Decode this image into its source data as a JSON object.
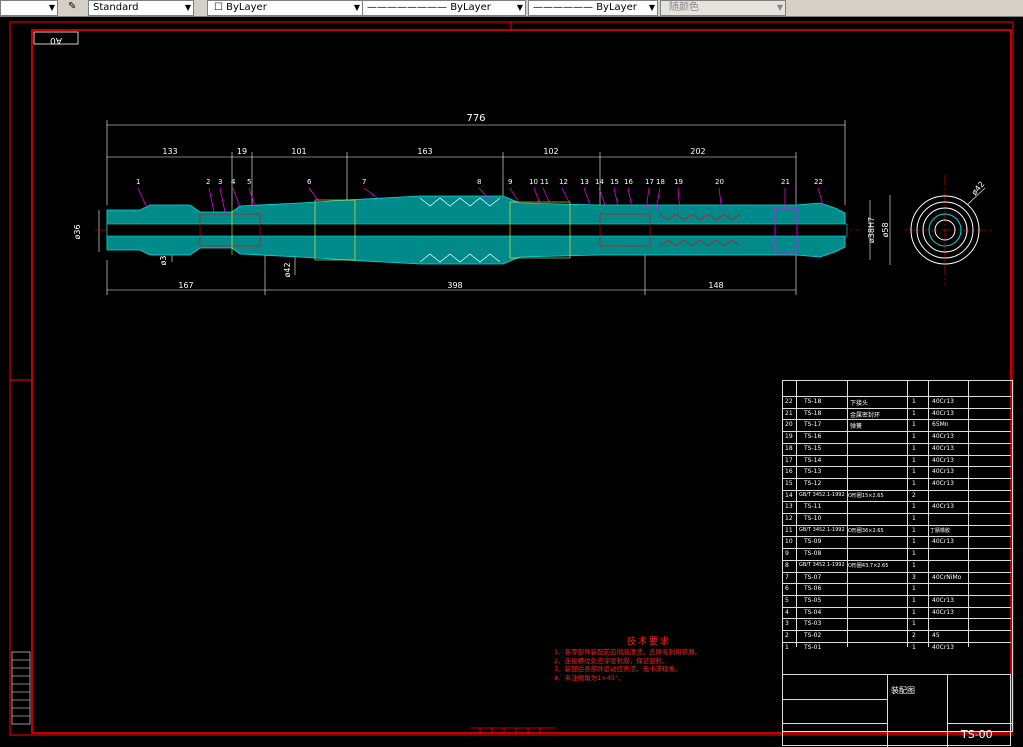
{
  "toolbar": {
    "textstyle": "Standard",
    "color": "ByLayer",
    "linetype": "ByLayer",
    "lineweight": "ByLayer",
    "plotstyle": "随颜色"
  },
  "drawing": {
    "sheet_size": "A0",
    "overall_length": "776",
    "top_dims": [
      "133",
      "19",
      "101",
      "163",
      "102",
      "202"
    ],
    "bottom_dims": [
      "167",
      "398",
      "148"
    ],
    "side_dims": [
      "ø36",
      "ø38",
      "ø42",
      "ø38H7",
      "ø58",
      "ø42"
    ],
    "balloons": [
      "1",
      "2",
      "3",
      "4",
      "5",
      "6",
      "7",
      "8",
      "9",
      "10",
      "11",
      "12",
      "13",
      "14",
      "15",
      "16",
      "17",
      "18",
      "19",
      "20",
      "21",
      "22"
    ]
  },
  "notes": {
    "title": "技术要求",
    "items": [
      "1、各零部件装配前应彻底清洗，去除毛刺和铁屑。",
      "2、连接螺纹处应涂密封胶，保证密封。",
      "3、装配后各部件运动应灵活，无卡滞现象。",
      "4、未注倒角为1×45°。"
    ]
  },
  "bom": [
    {
      "no": "22",
      "code": "TS-18",
      "name": "下接头",
      "qty": "1",
      "mat": "40Cr13"
    },
    {
      "no": "21",
      "code": "TS-18",
      "name": "金属密封环",
      "qty": "1",
      "mat": "40Cr13"
    },
    {
      "no": "20",
      "code": "TS-17",
      "name": "弹簧",
      "qty": "1",
      "mat": "65Mn"
    },
    {
      "no": "19",
      "code": "TS-16",
      "name": "",
      "qty": "1",
      "mat": "40Cr13"
    },
    {
      "no": "18",
      "code": "TS-15",
      "name": "",
      "qty": "1",
      "mat": "40Cr13"
    },
    {
      "no": "17",
      "code": "TS-14",
      "name": "",
      "qty": "1",
      "mat": "40Cr13"
    },
    {
      "no": "16",
      "code": "TS-13",
      "name": "",
      "qty": "1",
      "mat": "40Cr13"
    },
    {
      "no": "15",
      "code": "TS-12",
      "name": "",
      "qty": "1",
      "mat": "40Cr13"
    },
    {
      "no": "14",
      "code": "GB/T 3452.1-1992",
      "name": "O形圈15×2.65",
      "qty": "2",
      "mat": ""
    },
    {
      "no": "13",
      "code": "TS-11",
      "name": "",
      "qty": "1",
      "mat": "40Cr13"
    },
    {
      "no": "12",
      "code": "TS-10",
      "name": "",
      "qty": "1",
      "mat": ""
    },
    {
      "no": "11",
      "code": "GB/T 3452.1-1992",
      "name": "O形圈36×2.65",
      "qty": "1",
      "mat": "丁腈橡胶"
    },
    {
      "no": "10",
      "code": "TS-09",
      "name": "",
      "qty": "1",
      "mat": "40Cr13"
    },
    {
      "no": "9",
      "code": "TS-08",
      "name": "",
      "qty": "1",
      "mat": ""
    },
    {
      "no": "8",
      "code": "GB/T 3452.1-1992",
      "name": "O形圈43.7×2.65",
      "qty": "1",
      "mat": ""
    },
    {
      "no": "7",
      "code": "TS-07",
      "name": "",
      "qty": "3",
      "mat": "40CrNiMo"
    },
    {
      "no": "6",
      "code": "TS-06",
      "name": "",
      "qty": "1",
      "mat": ""
    },
    {
      "no": "5",
      "code": "TS-05",
      "name": "",
      "qty": "1",
      "mat": "40Cr13"
    },
    {
      "no": "4",
      "code": "TS-04",
      "name": "",
      "qty": "1",
      "mat": "40Cr13"
    },
    {
      "no": "3",
      "code": "TS-03",
      "name": "",
      "qty": "1",
      "mat": ""
    },
    {
      "no": "2",
      "code": "TS-02",
      "name": "",
      "qty": "2",
      "mat": "45"
    },
    {
      "no": "1",
      "code": "TS-01",
      "name": "",
      "qty": "1",
      "mat": "40Cr13"
    }
  ],
  "title_block": {
    "assembly_name": "装配图",
    "drawing_no": "TS-00"
  },
  "colors": {
    "frame": "#ff0000",
    "section_fill": "#00c0c0",
    "dims": "#ffffff",
    "leaders": "#ff00ff",
    "centerline": "#ff0000"
  }
}
